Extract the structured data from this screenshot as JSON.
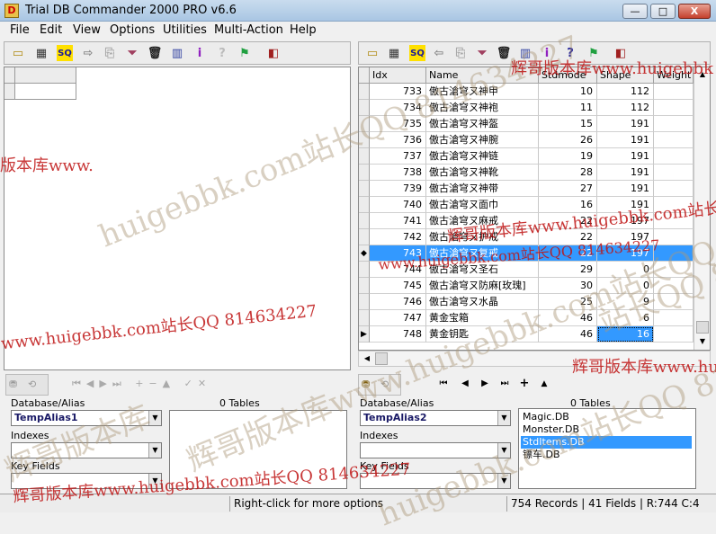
{
  "window": {
    "title": "Trial DB Commander 2000 PRO v6.6",
    "app_icon": "db-commander-icon",
    "minimize": "—",
    "maximize": "□",
    "close": "X"
  },
  "menu": [
    "File",
    "Edit",
    "View",
    "Options",
    "Utilities",
    "Multi-Action",
    "Help"
  ],
  "right_grid": {
    "columns": [
      "Idx",
      "Name",
      "Stdmode",
      "Shape",
      "Weight"
    ],
    "rows": [
      {
        "idx": "733",
        "name": "傲古滄穹ㄡ神甲",
        "stdmode": "10",
        "shape": "112"
      },
      {
        "idx": "734",
        "name": "傲古滄穹ㄡ神袍",
        "stdmode": "11",
        "shape": "112"
      },
      {
        "idx": "735",
        "name": "傲古滄穹ㄡ神盔",
        "stdmode": "15",
        "shape": "191"
      },
      {
        "idx": "736",
        "name": "傲古滄穹ㄡ神腕",
        "stdmode": "26",
        "shape": "191"
      },
      {
        "idx": "737",
        "name": "傲古滄穹ㄡ神链",
        "stdmode": "19",
        "shape": "191"
      },
      {
        "idx": "738",
        "name": "傲古滄穹ㄡ神靴",
        "stdmode": "28",
        "shape": "191"
      },
      {
        "idx": "739",
        "name": "傲古滄穹ㄡ神带",
        "stdmode": "27",
        "shape": "191"
      },
      {
        "idx": "740",
        "name": "傲古滄穹ㄡ面巾",
        "stdmode": "16",
        "shape": "191"
      },
      {
        "idx": "741",
        "name": "傲古滄穹ㄡ麻戒",
        "stdmode": "22",
        "shape": "197"
      },
      {
        "idx": "742",
        "name": "傲古滄穹ㄡ护戒",
        "stdmode": "22",
        "shape": "197"
      },
      {
        "idx": "743",
        "name": "傲古滄穹ㄡ复戒",
        "stdmode": "22",
        "shape": "197"
      },
      {
        "idx": "744",
        "name": "傲古滄穹ㄡ圣石",
        "stdmode": "29",
        "shape": "0"
      },
      {
        "idx": "745",
        "name": "傲古滄穹ㄡ防麻[玫瑰]",
        "stdmode": "30",
        "shape": "0"
      },
      {
        "idx": "746",
        "name": "傲古滄穹ㄡ水晶",
        "stdmode": "25",
        "shape": "9"
      },
      {
        "idx": "747",
        "name": "黄金宝箱",
        "stdmode": "46",
        "shape": "6"
      },
      {
        "idx": "748",
        "name": "黄金钥匙",
        "stdmode": "46",
        "shape": "16"
      }
    ],
    "selected_row_index": 10,
    "current_row_index": 15
  },
  "left_panel": {
    "db_label": "Database/Alias",
    "db_value": "TempAlias1",
    "tables_label": "0 Tables",
    "indexes_label": "Indexes",
    "keyfields_label": "Key Fields"
  },
  "right_panel": {
    "db_label": "Database/Alias",
    "db_value": "TempAlias2",
    "tables_label": "0 Tables",
    "indexes_label": "Indexes",
    "keyfields_label": "Key Fields",
    "tables": [
      "Magic.DB",
      "Monster.DB",
      "StdItems.DB",
      "镖车.DB"
    ],
    "selected_table_index": 2
  },
  "status": {
    "hint": "Right-click for more options",
    "records": "754 Records | 41 Fields | R:744 C:4"
  },
  "watermarks": {
    "w1": "huigebbk.com站长QQ 814634227",
    "w2": "版本库www.",
    "w3": "辉哥版本库www.huigebbk",
    "w4": "辉哥版本库www.huigebbk.com站长QQ 814634227",
    "w5": "www.huigebbk.com站长QQ 814634227",
    "w6": "辉哥版本库www.huigebbk.com站长QQ 814634227",
    "w7": "站长QQ 81",
    "w8": "辉哥版本库www.hu",
    "w9": "辉哥版本库www.huigebbk.com站长QQ 814634227",
    "w10": "辉哥版本库",
    "w11": "huigebbk.com站长QQ 814634227",
    "w12": "www.huigebbk.com站长QQ 814634227"
  }
}
